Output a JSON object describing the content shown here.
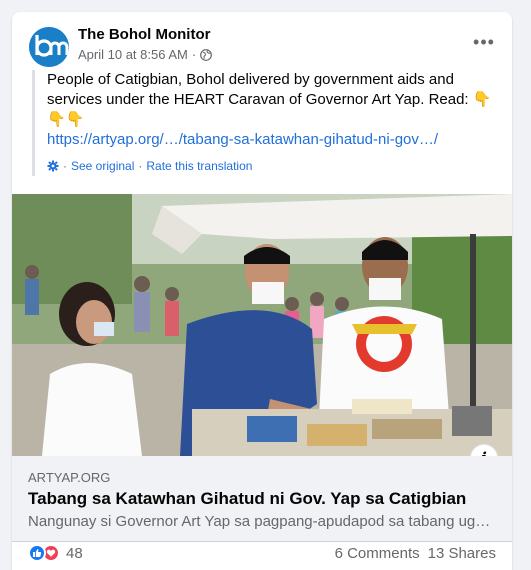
{
  "post": {
    "page_name": "The Bohol Monitor",
    "date": "April 10 at 8:56 AM",
    "meta_separator": "·",
    "more_label": "•••",
    "body": "People of Catigbian, Bohol delivered by government aids and services under the HEART Caravan of Governor Art Yap. Read: 👇👇👇",
    "link": "https://artyap.org/…/tabang-sa-katawhan-gihatud-ni-gov…/",
    "see_original": "See original",
    "rate_translation": "Rate this translation",
    "separator": "·"
  },
  "preview": {
    "domain": "ARTYAP.ORG",
    "title": "Tabang sa Katawhan Gihatud ni Gov. Yap sa Catigbian",
    "description": "Nangunay si Governor Art Yap sa pagpang-apudapod sa tabang ug…",
    "info_label": "i"
  },
  "stats": {
    "reaction_count": "48",
    "comments": "6 Comments",
    "shares": "13 Shares"
  },
  "icons": {
    "avatar": "bm-logo-icon",
    "privacy": "globe-icon",
    "translate": "gear-icon",
    "reactions": [
      "like-icon",
      "love-icon"
    ]
  },
  "colors": {
    "link": "#216fdb",
    "brand": "#1877f2",
    "secondary_text": "#65676b",
    "love": "#f33e58"
  }
}
